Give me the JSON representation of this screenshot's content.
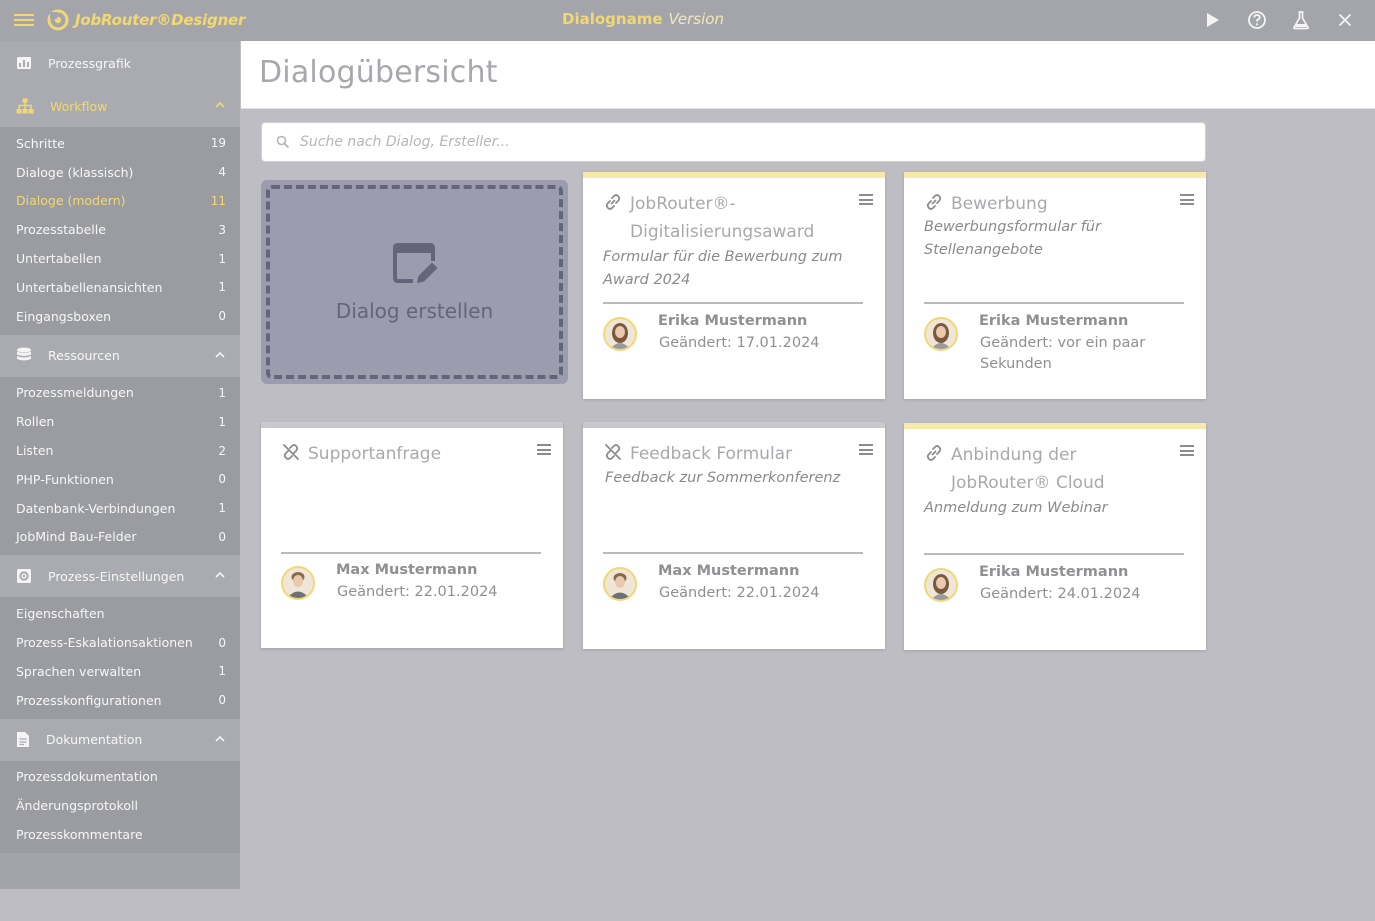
{
  "app": {
    "brand": "JobRouter®Designer",
    "dialog_name": "Dialogname",
    "version_label": "Version"
  },
  "sidebar": {
    "top_item": "Prozessgrafik",
    "sections": [
      {
        "label": "Workflow",
        "items": [
          {
            "label": "Schritte",
            "count": "19"
          },
          {
            "label": "Dialoge (klassisch)",
            "count": "4"
          },
          {
            "label": "Dialoge (modern)",
            "count": "11"
          },
          {
            "label": "Prozesstabelle",
            "count": "3"
          },
          {
            "label": "Untertabellen",
            "count": "1"
          },
          {
            "label": "Untertabellenansichten",
            "count": "1"
          },
          {
            "label": "Eingangsboxen",
            "count": "0"
          }
        ]
      },
      {
        "label": "Ressourcen",
        "items": [
          {
            "label": "Prozessmeldungen",
            "count": "1"
          },
          {
            "label": "Rollen",
            "count": "1"
          },
          {
            "label": "Listen",
            "count": "2"
          },
          {
            "label": "PHP-Funktionen",
            "count": "0"
          },
          {
            "label": "Datenbank-Verbindungen",
            "count": "1"
          },
          {
            "label": "JobMind Bau-Felder",
            "count": "0"
          }
        ]
      },
      {
        "label": "Prozess-Einstellungen",
        "items": [
          {
            "label": "Eigenschaften",
            "count": ""
          },
          {
            "label": "Prozess-Eskalationsaktionen",
            "count": "0"
          },
          {
            "label": "Sprachen verwalten",
            "count": "1"
          },
          {
            "label": "Prozesskonfigurationen",
            "count": "0"
          }
        ]
      },
      {
        "label": "Dokumentation",
        "items": [
          {
            "label": "Prozessdokumentation",
            "count": ""
          },
          {
            "label": "Änderungsprotokoll",
            "count": ""
          },
          {
            "label": "Prozesskommentare",
            "count": ""
          }
        ]
      }
    ]
  },
  "main": {
    "title": "Dialogübersicht",
    "search_placeholder": "Suche nach Dialog, Ersteller...",
    "create_label": "Dialog erstellen",
    "cards": [
      {
        "title": "JobRouter®-Digitalisierungsaward",
        "description": "Formular für die Bewerbung zum Award 2024",
        "author": "Erika Mustermann",
        "changed": "Geändert: 17.01.2024"
      },
      {
        "title": "Bewerbung",
        "description": "Bewerbungsformular für Stellenangebote",
        "author": "Erika Mustermann",
        "changed": "Geändert: vor ein paar Sekunden"
      },
      {
        "title": "Supportanfrage",
        "description": "",
        "author": "Max Mustermann",
        "changed": "Geändert: 22.01.2024"
      },
      {
        "title": "Feedback Formular",
        "description": "Feedback zur Sommerkonferenz",
        "author": "Max Mustermann",
        "changed": "Geändert: 22.01.2024"
      },
      {
        "title": "Anbindung der JobRouter® Cloud",
        "description": "Anmeldung zum Webinar",
        "author": "Erika Mustermann",
        "changed": "Geändert: 24.01.2024"
      }
    ]
  }
}
